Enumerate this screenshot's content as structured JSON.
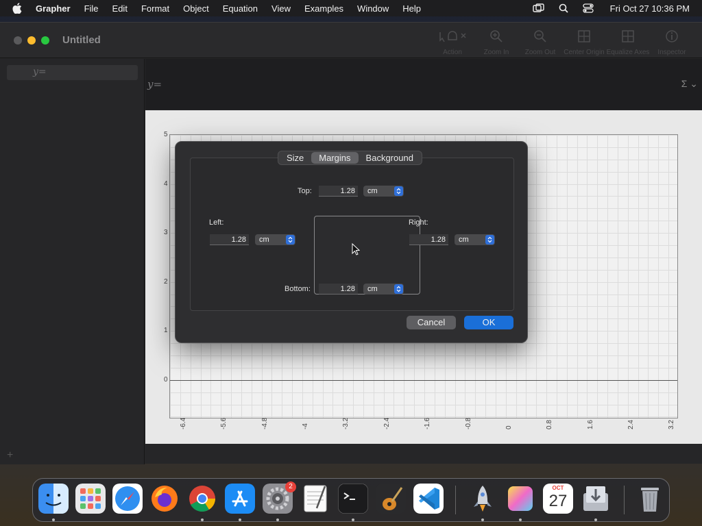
{
  "menubar": {
    "app_name": "Grapher",
    "items": [
      "File",
      "Edit",
      "Format",
      "Object",
      "Equation",
      "View",
      "Examples",
      "Window",
      "Help"
    ],
    "clock": "Fri Oct 27  10:36 PM"
  },
  "window": {
    "title": "Untitled",
    "toolbar": [
      {
        "label": "Action",
        "icon": "hand-cursor-icon"
      },
      {
        "label": "Zoom In",
        "icon": "zoom-in-icon"
      },
      {
        "label": "Zoom Out",
        "icon": "zoom-out-icon"
      },
      {
        "label": "Center Origin",
        "icon": "center-origin-icon"
      },
      {
        "label": "Equalize Axes",
        "icon": "equalize-axes-icon"
      },
      {
        "label": "Inspector",
        "icon": "info-icon"
      }
    ],
    "sidebar_placeholder": "y=",
    "equation_prompt": "y=",
    "sigma_label": "Σ"
  },
  "graph": {
    "y_ticks": [
      "5",
      "4",
      "3",
      "2",
      "1",
      "0"
    ],
    "x_ticks": [
      "-6.4",
      "-5.6",
      "-4.8",
      "-4",
      "-3.2",
      "-2.4",
      "-1.6",
      "-0.8",
      "0",
      "0.8",
      "1.6",
      "2.4",
      "3.2"
    ]
  },
  "dialog": {
    "tabs": [
      "Size",
      "Margins",
      "Background"
    ],
    "active_tab": "Margins",
    "top": {
      "label": "Top:",
      "value": "1.28",
      "unit": "cm"
    },
    "left": {
      "label": "Left:",
      "value": "1.28",
      "unit": "cm"
    },
    "right": {
      "label": "Right:",
      "value": "1.28",
      "unit": "cm"
    },
    "bottom": {
      "label": "Bottom:",
      "value": "1.28",
      "unit": "cm"
    },
    "cancel_label": "Cancel",
    "ok_label": "OK",
    "ok_color": "#1a6fd8"
  },
  "dock": {
    "apps": [
      "Finder",
      "Launchpad",
      "Safari",
      "Firefox",
      "Chrome",
      "App Store",
      "System Settings",
      "TextEdit",
      "Terminal",
      "GarageBand",
      "Visual Studio Code",
      "Rocket",
      "Grapher",
      "Calendar",
      "Downloads",
      "Trash"
    ],
    "settings_badge": "2",
    "calendar_month": "OCT",
    "calendar_day": "27"
  }
}
